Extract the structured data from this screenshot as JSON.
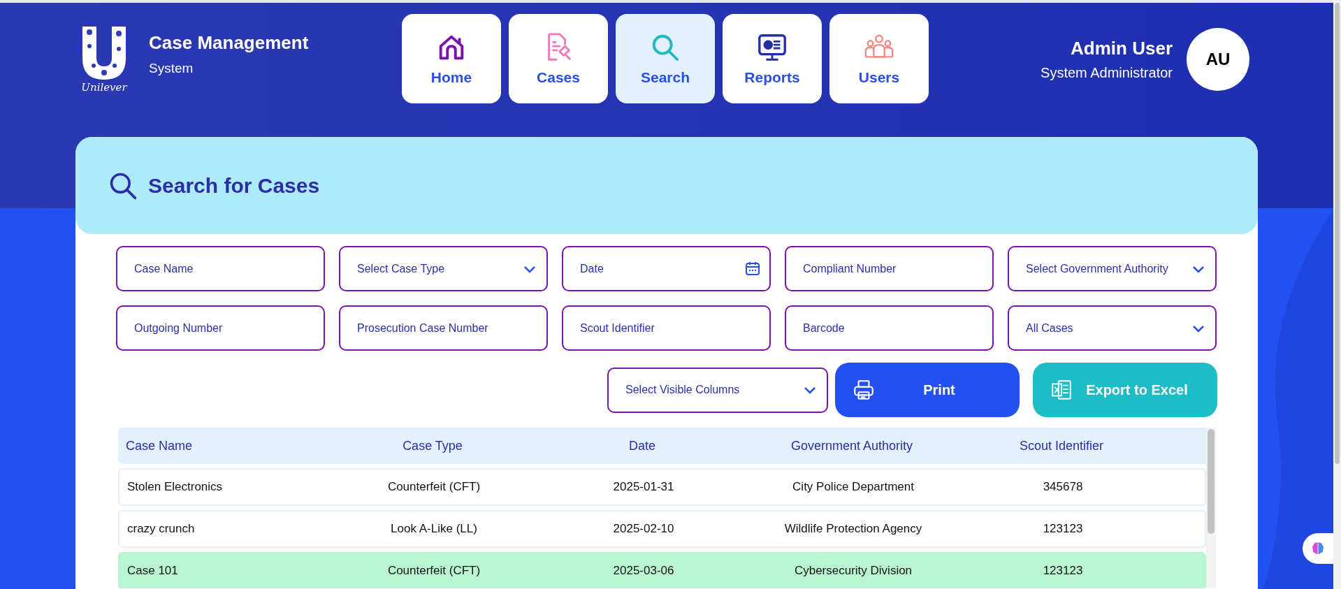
{
  "brand": {
    "logo_text": "Unilever",
    "title": "Case Management",
    "subtitle": "System"
  },
  "nav": [
    {
      "label": "Home",
      "selected": false
    },
    {
      "label": "Cases",
      "selected": false
    },
    {
      "label": "Search",
      "selected": true
    },
    {
      "label": "Reports",
      "selected": false
    },
    {
      "label": "Users",
      "selected": false
    }
  ],
  "user": {
    "name": "Admin User",
    "role": "System Administrator",
    "initials": "AU"
  },
  "search_panel": {
    "title": "Search for Cases",
    "filters": [
      {
        "kind": "text",
        "placeholder": "Case Name"
      },
      {
        "kind": "select",
        "placeholder": "Select Case Type"
      },
      {
        "kind": "date",
        "placeholder": "Date"
      },
      {
        "kind": "text",
        "placeholder": "Compliant Number"
      },
      {
        "kind": "select",
        "placeholder": "Select Government Authority"
      },
      {
        "kind": "text",
        "placeholder": "Outgoing Number"
      },
      {
        "kind": "text",
        "placeholder": "Prosecution Case Number"
      },
      {
        "kind": "text",
        "placeholder": "Scout Identifier"
      },
      {
        "kind": "text",
        "placeholder": "Barcode"
      },
      {
        "kind": "select",
        "placeholder": "All Cases"
      }
    ],
    "column_picker": {
      "placeholder": "Select Visible Columns"
    },
    "buttons": [
      {
        "kind": "print",
        "label": "Print"
      },
      {
        "kind": "excel",
        "label": "Export to Excel"
      }
    ]
  },
  "table": {
    "columns": [
      "Case Name",
      "Case Type",
      "Date",
      "Government Authority",
      "Scout Identifier"
    ],
    "rows": [
      {
        "cells": [
          "Stolen Electronics",
          "Counterfeit (CFT)",
          "2025-01-31",
          "City Police Department",
          "345678"
        ],
        "selected": false
      },
      {
        "cells": [
          "crazy crunch",
          "Look A-Like (LL)",
          "2025-02-10",
          "Wildlife Protection Agency",
          "123123"
        ],
        "selected": false
      },
      {
        "cells": [
          "Case 101",
          "Counterfeit (CFT)",
          "2025-03-06",
          "Cybersecurity Division",
          "123123"
        ],
        "selected": true
      }
    ]
  }
}
